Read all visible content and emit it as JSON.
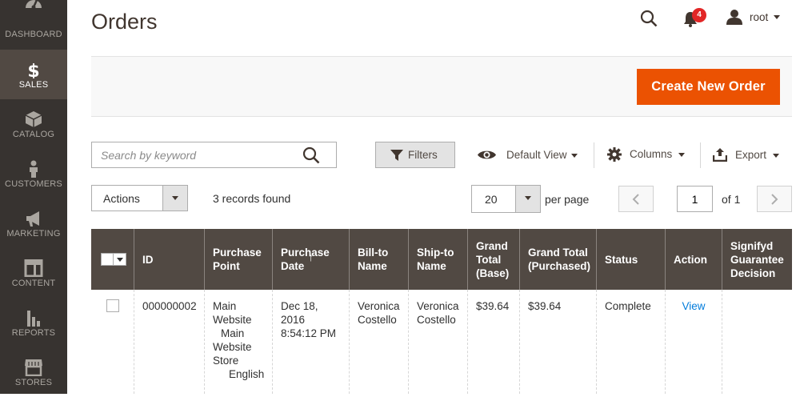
{
  "nav": [
    {
      "label": "DASHBOARD",
      "icon": "dashboard-icon",
      "active": false
    },
    {
      "label": "SALES",
      "icon": "dollar-icon",
      "active": true
    },
    {
      "label": "CATALOG",
      "icon": "box-icon",
      "active": false
    },
    {
      "label": "CUSTOMERS",
      "icon": "person-icon",
      "active": false
    },
    {
      "label": "MARKETING",
      "icon": "megaphone-icon",
      "active": false
    },
    {
      "label": "CONTENT",
      "icon": "layout-icon",
      "active": false
    },
    {
      "label": "REPORTS",
      "icon": "bar-chart-icon",
      "active": false
    },
    {
      "label": "STORES",
      "icon": "storefront-icon",
      "active": false
    }
  ],
  "header": {
    "title": "Orders",
    "notifications_count": "4",
    "user": "root"
  },
  "actions_bar": {
    "create_label": "Create New Order"
  },
  "toolbar": {
    "search_placeholder": "Search by keyword",
    "filters_label": "Filters",
    "view_label": "Default View",
    "columns_label": "Columns",
    "export_label": "Export"
  },
  "pager": {
    "actions_label": "Actions",
    "records_text": "3 records found",
    "per_page_value": "20",
    "per_page_label": "per page",
    "page_value": "1",
    "of_label": "of 1"
  },
  "grid": {
    "columns": [
      "ID",
      "Purchase Point",
      "Purchase Date",
      "Bill-to Name",
      "Ship-to Name",
      "Grand Total (Base)",
      "Grand Total (Purchased)",
      "Status",
      "Action",
      "Signifyd Guarantee Decision"
    ],
    "rows": [
      {
        "id": "000000002",
        "purchase_point": [
          "Main",
          "Website",
          "Main",
          "Website",
          "Store",
          "English"
        ],
        "purchase_date": [
          "Dec 18,",
          "2016",
          "8:54:12 PM"
        ],
        "bill_to": [
          "Veronica",
          "Costello"
        ],
        "ship_to": [
          "Veronica",
          "Costello"
        ],
        "grand_total_base": "$39.64",
        "grand_total_purchased": "$39.64",
        "status": "Complete",
        "action": "View",
        "signifyd": ""
      }
    ]
  },
  "colors": {
    "sidebar": "#373330",
    "sidebar_active": "#514943",
    "accent": "#eb5202",
    "grid_header": "#514943",
    "link": "#007bdb",
    "badge": "#e22626"
  }
}
